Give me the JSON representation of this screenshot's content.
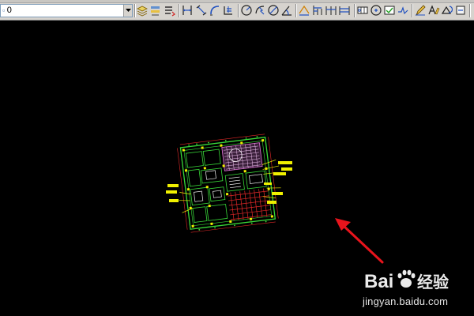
{
  "toolbar": {
    "layer_value": "0",
    "icons": [
      "layer-dropdown-icon",
      "layer-properties-icon",
      "layer-state-icon",
      "layer-previous-icon",
      "dim-linear-icon",
      "dim-aligned-icon",
      "dim-arc-icon",
      "dim-ordinate-icon",
      "dim-radius-icon",
      "dim-jogged-icon",
      "dim-diameter-icon",
      "dim-angular-icon",
      "dim-quick-icon",
      "dim-baseline-icon",
      "dim-continue-icon",
      "dim-space-icon",
      "tolerance-icon",
      "center-mark-icon",
      "inspect-icon",
      "jogged-linear-icon",
      "dim-edit-icon",
      "dim-text-edit-icon",
      "dim-update-icon"
    ]
  },
  "watermark": {
    "brand_text": "Bai",
    "brand_suffix": "经验",
    "url": "jingyan.baidu.com"
  },
  "colors": {
    "canvas_background": "#000000",
    "toolbar_background": "#d6d3ce",
    "arrow": "#e8141c",
    "drawing_green": "#38d838",
    "drawing_red": "#e02828",
    "drawing_yellow": "#f0f000",
    "drawing_white": "#f0f0f0",
    "drawing_magenta": "#e070d8"
  }
}
